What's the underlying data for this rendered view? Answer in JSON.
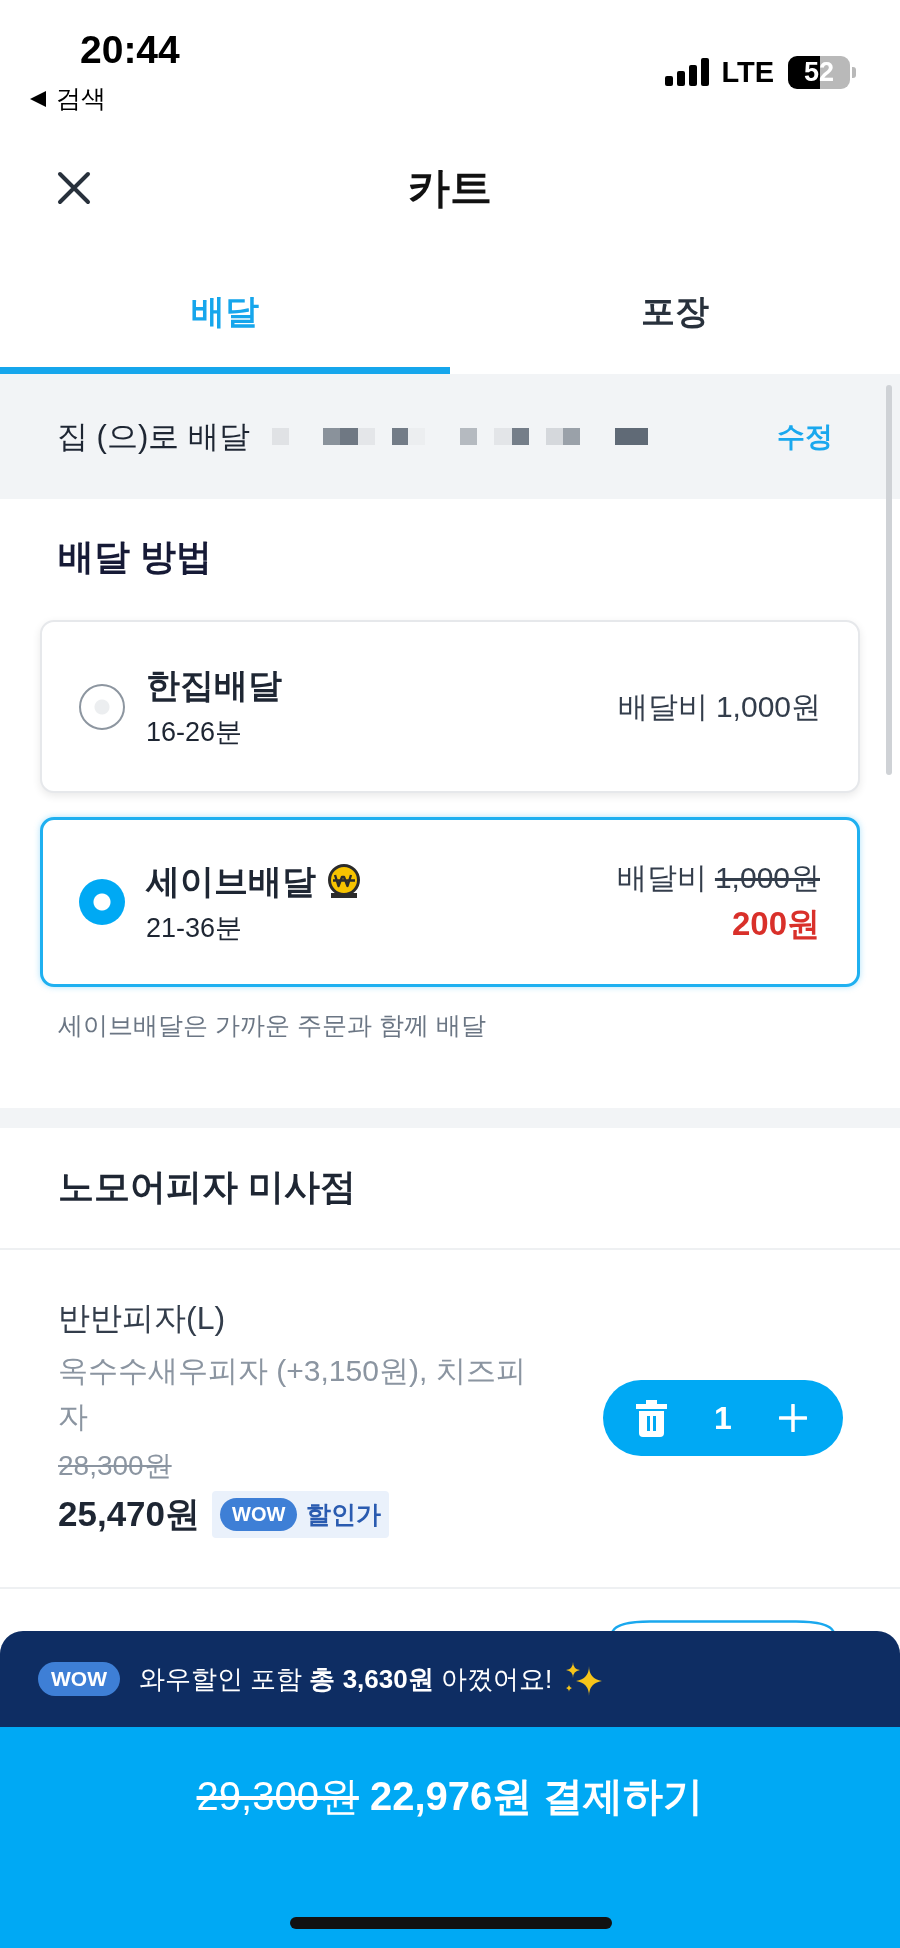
{
  "status_bar": {
    "time": "20:44",
    "back_label": "검색",
    "network": "LTE",
    "battery": "52"
  },
  "header": {
    "title": "카트"
  },
  "tabs": [
    {
      "label": "배달",
      "selected": true
    },
    {
      "label": "포장",
      "selected": false
    }
  ],
  "address": {
    "label": "집 (으)로 배달",
    "edit": "수정"
  },
  "delivery_methods": {
    "title": "배달 방법",
    "options": [
      {
        "name": "한집배달",
        "time": "16-26분",
        "fee_label": "배달비",
        "fee": "1,000원",
        "selected": false,
        "icon": false
      },
      {
        "name": "세이브배달",
        "time": "21-36분",
        "fee_label": "배달비",
        "fee": "1,000원",
        "discounted_fee": "200원",
        "selected": true,
        "icon": true
      }
    ],
    "note": "세이브배달은 가까운 주문과 함께 배달"
  },
  "store": {
    "name": "노모어피자 미사점",
    "items": [
      {
        "name": "반반피자(L)",
        "options": "옥수수새우피자 (+3,150원), 치즈피자",
        "original_price": "28,300원",
        "price": "25,470원",
        "tag": {
          "badge": "WOW",
          "label": "할인가"
        },
        "quantity": "1"
      }
    ]
  },
  "savings_banner": {
    "badge": "WOW",
    "text": "와우할인 포함 **총 3,630원** 아꼈어요!"
  },
  "pay_button": {
    "original_price": "29,300원",
    "label": "22,976원 결제하기"
  }
}
